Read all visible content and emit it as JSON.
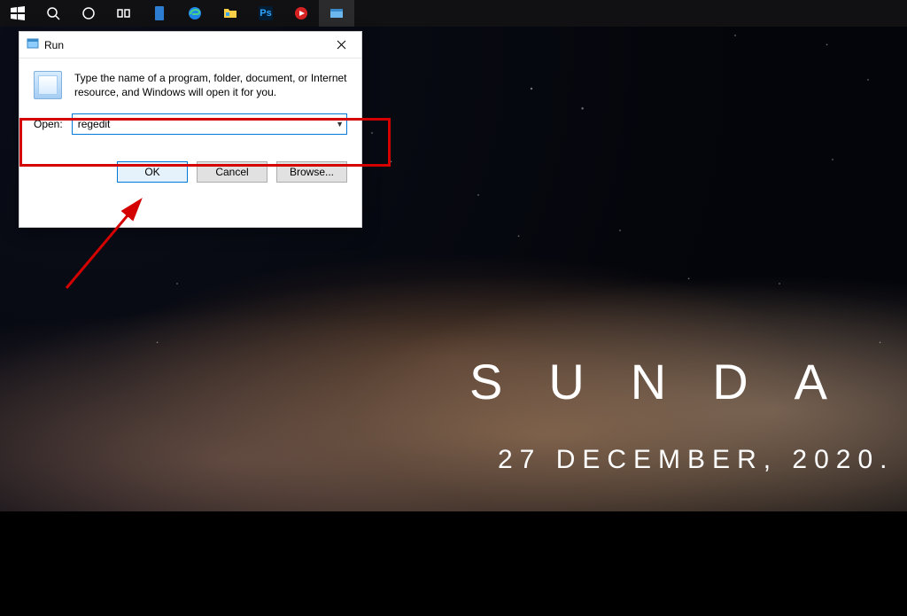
{
  "taskbar": {
    "items": [
      {
        "name": "start-button",
        "icon_name": "windows-icon"
      },
      {
        "name": "search-button",
        "icon_name": "search-icon"
      },
      {
        "name": "cortana-button",
        "icon_name": "cortana-icon"
      },
      {
        "name": "taskview-button",
        "icon_name": "taskview-icon"
      },
      {
        "name": "tasklink-button",
        "icon_name": "link-icon"
      },
      {
        "name": "edge-app",
        "icon_name": "edge-icon"
      },
      {
        "name": "file-explorer-app",
        "icon_name": "folder-icon"
      },
      {
        "name": "photoshop-app",
        "icon_name": "ps-icon"
      },
      {
        "name": "media-app",
        "icon_name": "media-icon"
      },
      {
        "name": "explorer-window",
        "icon_name": "window-icon"
      }
    ]
  },
  "wallpaper": {
    "day_word": "SUNDA",
    "date_text": "27 DECEMBER, 2020."
  },
  "run_dialog": {
    "title": "Run",
    "description": "Type the name of a program, folder, document, or Internet resource, and Windows will open it for you.",
    "open_label": "Open:",
    "input_value": "regedit",
    "buttons": {
      "ok": "OK",
      "cancel": "Cancel",
      "browse": "Browse..."
    }
  }
}
